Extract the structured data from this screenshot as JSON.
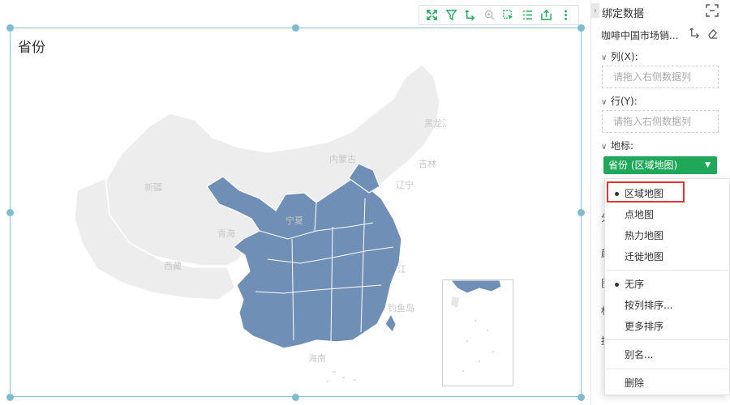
{
  "chart": {
    "title": "省份",
    "toolbar": [
      {
        "name": "fullscreen-icon"
      },
      {
        "name": "filter-icon"
      },
      {
        "name": "drill-icon"
      },
      {
        "name": "zoom-icon"
      },
      {
        "name": "select-icon"
      },
      {
        "name": "list-icon"
      },
      {
        "name": "export-icon"
      },
      {
        "name": "more-icon"
      }
    ],
    "map_labels": {
      "heilongjiang": "黑龙江",
      "neimenggu": "内蒙古",
      "jilin": "吉林",
      "liaoning": "辽宁",
      "xinjiang": "新疆",
      "qinghai": "青海",
      "xizang": "西藏",
      "ningxia": "宁夏",
      "jiangsu": "江",
      "diaoyu": "钓鱼岛",
      "hainan": "海南"
    },
    "colors": {
      "highlight_region": "#6f8fb6",
      "base_region": "#ededed",
      "border": "#ffffff",
      "accent": "#1fa85a"
    }
  },
  "panel": {
    "title": "绑定数据",
    "dataset": "咖啡中国市场销...",
    "col_section": "列(X):",
    "col_placeholder": "请拖入右侧数据列",
    "row_section": "行(Y):",
    "row_placeholder": "请拖入右侧数据列",
    "geo_section": "地标:",
    "geo_field": "省份 (区域地图)",
    "partial_labels": [
      "分",
      "颜",
      "图",
      "标",
      "提"
    ]
  },
  "menu": {
    "map_types": [
      {
        "label": "区域地图",
        "selected": true
      },
      {
        "label": "点地图",
        "selected": false
      },
      {
        "label": "热力地图",
        "selected": false
      },
      {
        "label": "迁徙地图",
        "selected": false
      }
    ],
    "sort": [
      {
        "label": "无序",
        "selected": true
      },
      {
        "label": "按列排序...",
        "selected": false
      },
      {
        "label": "更多排序",
        "selected": false
      }
    ],
    "alias": "别名...",
    "delete": "删除"
  }
}
